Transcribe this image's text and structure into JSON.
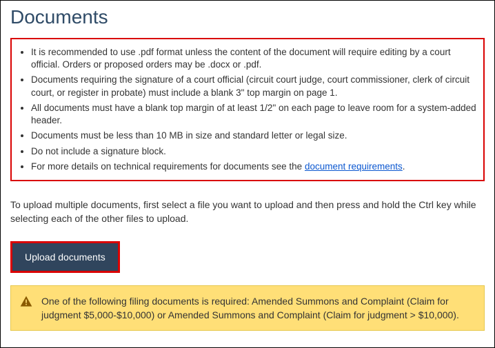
{
  "header": {
    "title": "Documents"
  },
  "requirements": {
    "items": [
      "It is recommended to use .pdf format unless the content of the document will require editing by a court official. Orders or proposed orders may be .docx or .pdf.",
      "Documents requiring the signature of a court official (circuit court judge, court commissioner, clerk of circuit court, or register in probate) must include a blank 3\" top margin on page 1.",
      "All documents must have a blank top margin of at least 1/2\" on each page to leave room for a system-added header.",
      "Documents must be less than 10 MB in size and standard letter or legal size.",
      "Do not include a signature block."
    ],
    "more_prefix": "For more details on technical requirements for documents see the ",
    "more_link": "document requirements",
    "more_suffix": "."
  },
  "instructions": {
    "text": "To upload multiple documents, first select a file you want to upload and then press and hold the Ctrl key while selecting each of the other files to upload."
  },
  "actions": {
    "upload_label": "Upload documents"
  },
  "alert": {
    "text": "One of the following filing documents is required: Amended Summons and Complaint (Claim for judgment $5,000-$10,000) or Amended Summons and Complaint (Claim for judgment > $10,000)."
  }
}
